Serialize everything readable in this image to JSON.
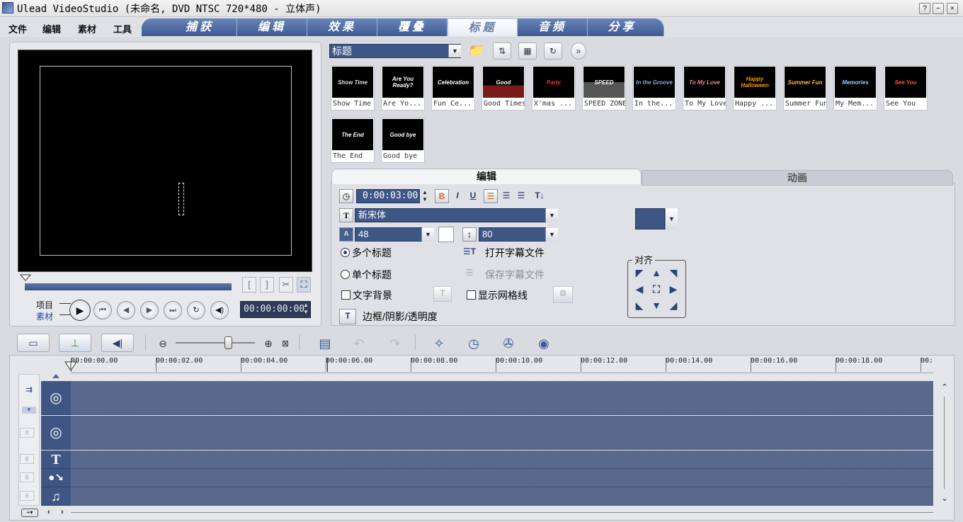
{
  "window": {
    "title": "Ulead VideoStudio (未命名, DVD NTSC 720*480 - 立体声)",
    "help_btn": "?",
    "min_btn": "−",
    "close_btn": "×"
  },
  "menu": [
    "文件",
    "编辑",
    "素材",
    "工具"
  ],
  "tabs": [
    "捕获",
    "编辑",
    "效果",
    "覆叠",
    "标题",
    "音频",
    "分享"
  ],
  "active_tab": "标题",
  "preview": {
    "mode_project": "项目",
    "mode_clip": "素材",
    "timecode": "00:00:00:00",
    "mark_in": "[",
    "mark_out": "]"
  },
  "library": {
    "category": "标题",
    "items": [
      {
        "art": "Show Time",
        "caption": "Show Time"
      },
      {
        "art": "Are You Ready?",
        "caption": "Are Yo..."
      },
      {
        "art": "Celebration",
        "caption": "Fun Ce..."
      },
      {
        "art": "Good",
        "caption": "Good Times"
      },
      {
        "art": "Party",
        "caption": "X'mas ..."
      },
      {
        "art": "SPEED",
        "caption": "SPEED ZONE"
      },
      {
        "art": "In the Groove",
        "caption": "In the..."
      },
      {
        "art": "To My Love",
        "caption": "To My Love"
      },
      {
        "art": "Happy Halloween",
        "caption": "Happy ..."
      },
      {
        "art": "Summer Fun",
        "caption": "Summer Fun"
      },
      {
        "art": "Memories",
        "caption": "My Mem..."
      },
      {
        "art": "See You",
        "caption": "See You"
      },
      {
        "art": "The End",
        "caption": "The End"
      },
      {
        "art": "Good bye",
        "caption": "Good bye"
      }
    ]
  },
  "edit": {
    "tab_edit": "编辑",
    "tab_animation": "动画",
    "duration": "0:00:03:00",
    "bold": "B",
    "italic": "I",
    "underline": "U",
    "font": "新宋体",
    "font_size": "48",
    "line_spacing": "80",
    "multi_title": "多个标题",
    "single_title": "单个标题",
    "text_background": "文字背景",
    "open_subtitle": "打开字幕文件",
    "save_subtitle": "保存字幕文件",
    "show_grid": "显示网格线",
    "border_shadow": "边框/阴影/透明度",
    "align_label": "对齐"
  },
  "timeline": {
    "ticks": [
      "00:00:00.00",
      "00:00:02.00",
      "00:00:04.00",
      "00:00:06.00",
      "00:00:08.00",
      "00:00:10.00",
      "00:00:12.00",
      "00:00:14.00",
      "00:00:16.00",
      "00:00:18.00",
      "00:"
    ]
  },
  "colors": {
    "accent": "#3d5686",
    "track": "#5a6a8f",
    "tab": "#4f6aa3"
  }
}
